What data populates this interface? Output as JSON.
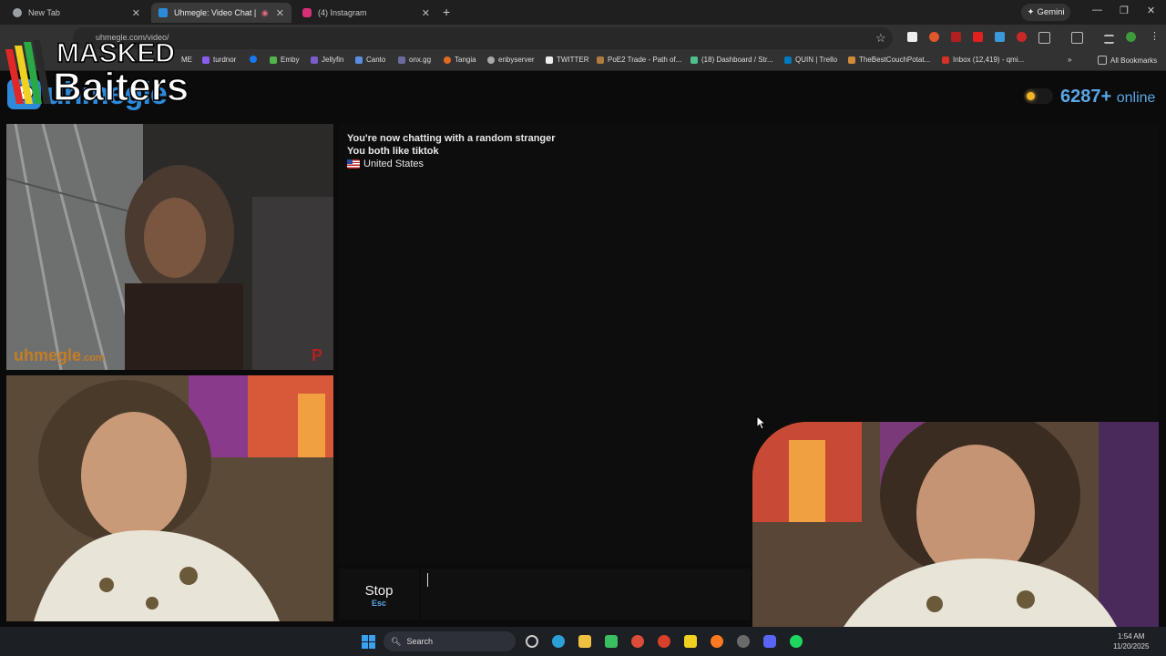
{
  "browser": {
    "tabs": [
      {
        "label": "New Tab"
      },
      {
        "label": "Uhmegle: Video Chat | Ran"
      },
      {
        "label": "(4) Instagram"
      }
    ],
    "gemini_label": "Gemini",
    "url": "uhmegle.com/video/",
    "bookmarks": [
      "ME",
      "turdnor",
      "",
      "Emby",
      "Jellyfin",
      "Canto",
      "onx.gg",
      "Tangia",
      "enbyserver",
      "TWITTER",
      "PoE2 Trade - Path of...",
      "(18) Dashboard / Str...",
      "QUIN | Trello",
      "TheBestCouchPotat...",
      "Inbox (12,419) - qmi..."
    ],
    "all_bookmarks_label": "All Bookmarks"
  },
  "overlay": {
    "line1": "MASKED",
    "line2": "Baiters"
  },
  "site": {
    "brand": "uhmegle",
    "online_count": "6287+",
    "online_label": "online",
    "watermark_main": "uhmegle",
    "watermark_suffix": ".com"
  },
  "chat": {
    "messages": [
      "You're now chatting with a random stranger",
      "You both like tiktok"
    ],
    "country": "United States",
    "stop_label": "Stop",
    "stop_shortcut": "Esc",
    "input_value": ""
  },
  "taskbar": {
    "search_label": "Search",
    "time": "1:54 AM",
    "date": "11/20/2025"
  }
}
